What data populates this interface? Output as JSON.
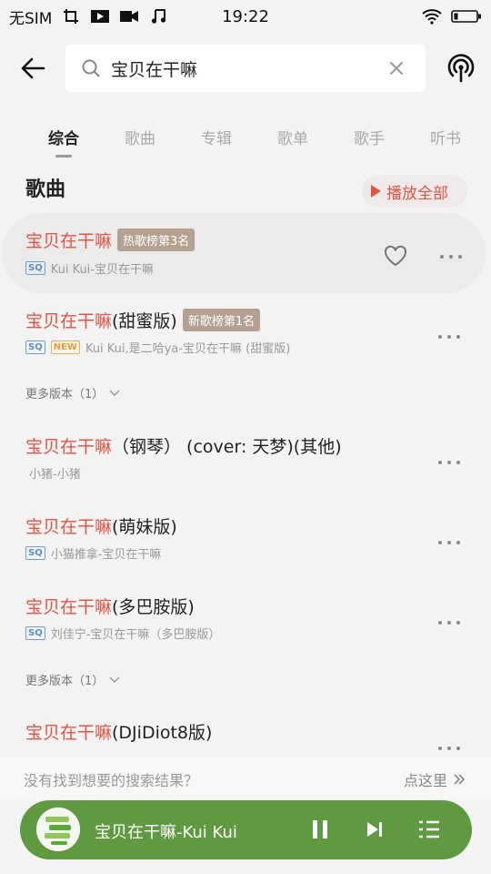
{
  "status_bar": {
    "carrier": "无SIM",
    "time": "19:22"
  },
  "search": {
    "query": "宝贝在干嘛"
  },
  "tabs": [
    {
      "label": "综合",
      "active": true
    },
    {
      "label": "歌曲"
    },
    {
      "label": "专辑"
    },
    {
      "label": "歌单"
    },
    {
      "label": "歌手"
    },
    {
      "label": "听书"
    }
  ],
  "section": {
    "title": "歌曲",
    "play_all": "播放全部"
  },
  "songs": [
    {
      "title_red": "宝贝在干嘛",
      "title_rest": "",
      "badge": "热歌榜第3名",
      "sq": "SQ",
      "new": "",
      "subtitle": "Kui Kui-宝贝在干嘛"
    },
    {
      "title_red": "宝贝在干嘛",
      "title_rest": "(甜蜜版)",
      "badge": "新歌榜第1名",
      "sq": "SQ",
      "new": "NEW",
      "subtitle": "Kui Kui,是二哈ya-宝贝在干嘛 (甜蜜版)"
    },
    {
      "title_red": "宝贝在干嘛",
      "title_rest": "（钢琴） (cover: 天梦)(其他)",
      "badge": "",
      "sq": "",
      "new": "",
      "subtitle": "小猪-小猪"
    },
    {
      "title_red": "宝贝在干嘛",
      "title_rest": "(萌妹版)",
      "badge": "",
      "sq": "SQ",
      "new": "",
      "subtitle": "小猫推拿-宝贝在干嘛"
    },
    {
      "title_red": "宝贝在干嘛",
      "title_rest": "(多巴胺版)",
      "badge": "",
      "sq": "SQ",
      "new": "",
      "subtitle": "刘佳宁-宝贝在干嘛（多巴胺版）"
    },
    {
      "title_red": "宝贝在干嘛",
      "title_rest": "(DJiDiot8版)",
      "badge": "",
      "sq": "",
      "new": "",
      "subtitle": ""
    }
  ],
  "more_versions": {
    "label": "更多版本（1）"
  },
  "not_found": {
    "text": "没有找到想要的搜索结果？",
    "link": "点这里"
  },
  "player": {
    "now_playing": "宝贝在干嘛-Kui Kui"
  },
  "colors": {
    "accent": "#e8523f",
    "player_bg": "#5f9a40",
    "badge": "#b6a190"
  }
}
